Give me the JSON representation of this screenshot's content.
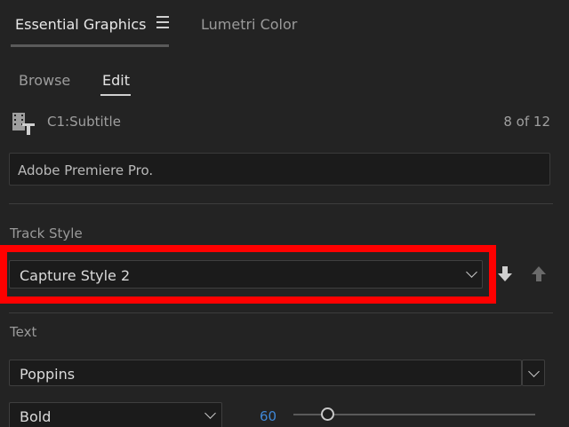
{
  "tabs": {
    "essential_graphics": "Essential Graphics",
    "lumetri_color": "Lumetri Color"
  },
  "subtabs": {
    "browse": "Browse",
    "edit": "Edit"
  },
  "clip": {
    "name": "C1:Subtitle",
    "count": "8 of 12"
  },
  "text_content": "Adobe Premiere Pro.",
  "track_style": {
    "label": "Track Style",
    "selected": "Capture Style 2"
  },
  "text_section": {
    "label": "Text",
    "font": "Poppins",
    "weight": "Bold",
    "size": "60",
    "size_slider_fraction": 0.14
  },
  "colors": {
    "highlight": "#ff0000",
    "accent_value": "#3f87d6"
  },
  "icons": [
    "menu-icon",
    "subtitle-track-icon",
    "chevron-down-icon",
    "push-down-arrow-icon",
    "push-up-arrow-icon"
  ]
}
